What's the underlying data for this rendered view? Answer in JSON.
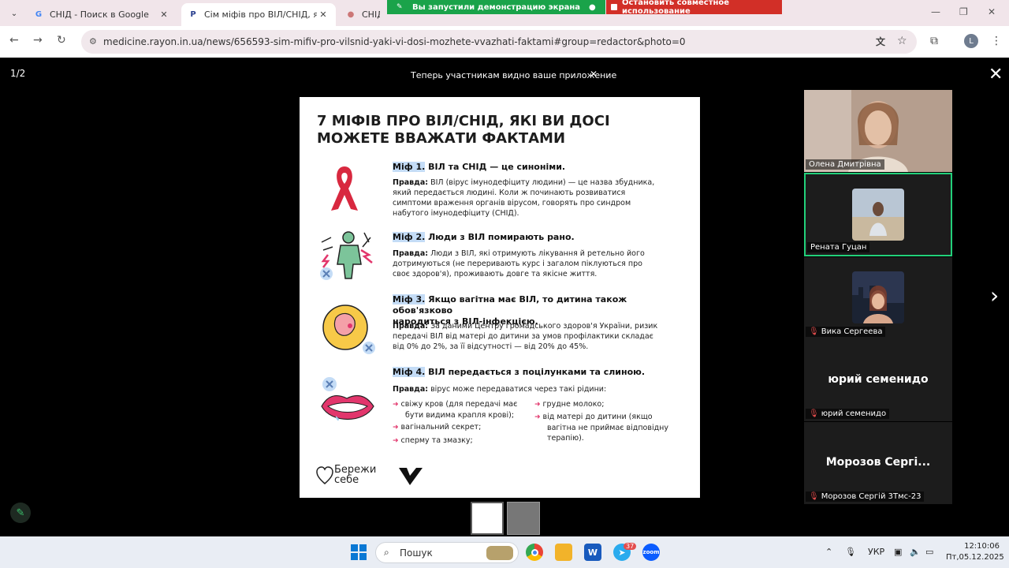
{
  "browser": {
    "tabs": [
      {
        "title": "СНІД - Поиск в Google",
        "icon": "google-icon"
      },
      {
        "title": "Сім міфів про ВІЛ/СНІД, які ви",
        "icon": "rayon-icon"
      },
      {
        "title": "СНІД – це не вирок – Зоряни",
        "icon": "site-icon"
      }
    ],
    "url": "medicine.rayon.in.ua/news/656593-sim-mifiv-pro-vilsnid-yaki-vi-dosi-mozhete-vvazhati-faktami#group=redactor&photo=0",
    "profile_initial": "L"
  },
  "screen_share": {
    "status": "Вы запустили демонстрацию экрана",
    "stop": "Остановить совместное использование",
    "notice": "Теперь участникам видно ваше приложение"
  },
  "viewer": {
    "counter": "1/2"
  },
  "slide": {
    "title_line1": "7 МІФІВ ПРО ВІЛ/СНІД, ЯКІ ВИ ДОСІ",
    "title_line2": "МОЖЕТЕ ВВАЖАТИ ФАКТАМИ",
    "myths": [
      {
        "marker": "Міф 1.",
        "heading": "ВІЛ та СНІД — це синоніми.",
        "truth_label": "Правда:",
        "truth_lines": [
          " ВІЛ (вірус імунодефіциту людини) — це назва збудника,",
          "який передається людині. Коли ж починають розвиватися",
          "симптоми враження органів вірусом, говорять про синдром",
          "набутого імунодефіциту (СНІД)."
        ]
      },
      {
        "marker": "Міф 2.",
        "heading": "Люди з ВІЛ помирають рано.",
        "truth_label": "Правда:",
        "truth_lines": [
          " Люди з ВІЛ, які отримують лікування й ретельно його",
          "дотримуються (не переривають курс і загалом піклуються про",
          "своє здоров'я), проживають довге та якісне життя."
        ]
      },
      {
        "marker": "Міф 3.",
        "heading_line1": "Якщо вагітна має ВІЛ, то дитина також обов'язково",
        "heading_line2": "народиться з ВІЛ-інфекцією.",
        "truth_label": "Правда:",
        "truth_lines": [
          " За даними Центру громадського здоров'я України, ризик",
          "передачі ВІЛ від матері до дитини за умов профілактики складає",
          "від 0% до 2%, за її відсутності — від 20% до 45%."
        ]
      },
      {
        "marker": "Міф 4.",
        "heading": "ВІЛ передається з поцілунками та слиною.",
        "truth_label": "Правда:",
        "truth_text": " вірус може передаватися через такі рідини:",
        "fluids_left": [
          [
            "свіжу кров (для передачі має",
            "бути видима крапля крові);"
          ],
          [
            "вагінальний секрет;"
          ],
          [
            "сперму та змазку;"
          ]
        ],
        "fluids_right": [
          [
            "грудне молоко;"
          ],
          [
            "від матері до дитини (якщо",
            "вагітна не приймає відповідну",
            "терапію)."
          ]
        ]
      }
    ],
    "logo_line1": "Бережи",
    "logo_line2": "себе"
  },
  "participants": [
    {
      "name": "Олена Дмитрівна",
      "muted": false
    },
    {
      "name": "Рената Гуцан",
      "muted": false
    },
    {
      "name": "Вика Сергеева",
      "muted": true
    },
    {
      "name": "юрий семенидо",
      "big_name": "юрий семенидо",
      "muted": true
    },
    {
      "name": "Морозов Сергій 3Тмс-23",
      "big_name": "Морозов  Сергі...",
      "muted": true
    }
  ],
  "taskbar": {
    "search_placeholder": "Пошук",
    "telegram_badge": "37",
    "language": "УКР",
    "time": "12:10:06",
    "date": "Пт,05.12.2025"
  },
  "colors": {
    "share_green": "#1aa34a",
    "share_red": "#d22f27",
    "active_speaker": "#22d07a",
    "myth_highlight": "#c4dcf6",
    "arrow_pink": "#e2366c",
    "ribbon_red": "#d8283f"
  }
}
